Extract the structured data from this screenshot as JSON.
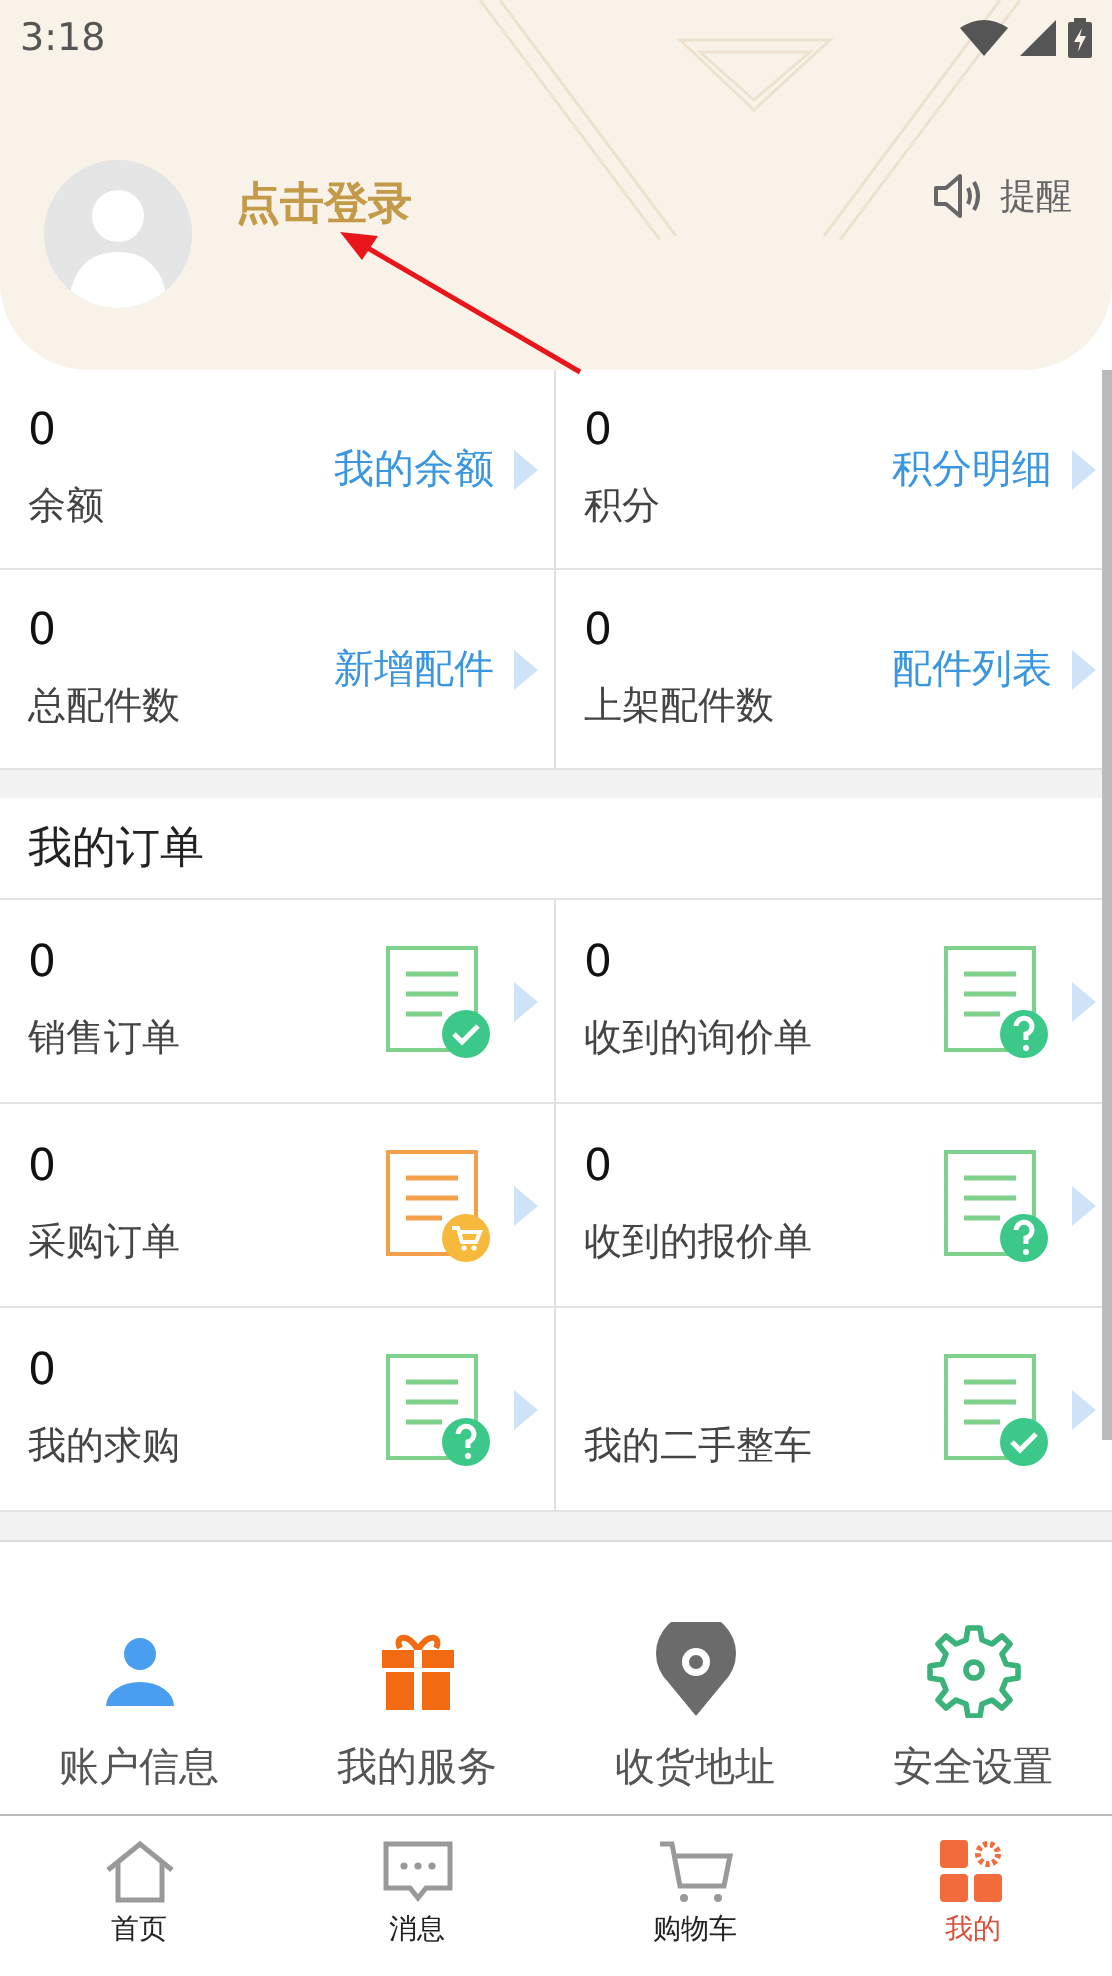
{
  "status_bar": {
    "time": "3:18"
  },
  "header": {
    "login_text": "点击登录",
    "reminder": "提醒"
  },
  "stats": [
    {
      "value": "0",
      "label": "余额",
      "link": "我的余额"
    },
    {
      "value": "0",
      "label": "积分",
      "link": "积分明细"
    },
    {
      "value": "0",
      "label": "总配件数",
      "link": "新增配件"
    },
    {
      "value": "0",
      "label": "上架配件数",
      "link": "配件列表"
    }
  ],
  "orders": {
    "title": "我的订单",
    "items": [
      {
        "value": "0",
        "label": "销售订单",
        "kind": "check"
      },
      {
        "value": "0",
        "label": "收到的询价单",
        "kind": "question"
      },
      {
        "value": "0",
        "label": "采购订单",
        "kind": "cart"
      },
      {
        "value": "0",
        "label": "收到的报价单",
        "kind": "question"
      },
      {
        "value": "0",
        "label": "我的求购",
        "kind": "question"
      },
      {
        "label": "我的二手整车",
        "kind": "check"
      }
    ]
  },
  "services": [
    {
      "label": "账户信息",
      "kind": "person"
    },
    {
      "label": "我的服务",
      "kind": "gift"
    },
    {
      "label": "收货地址",
      "kind": "pin"
    },
    {
      "label": "安全设置",
      "kind": "gear"
    }
  ],
  "nav": [
    {
      "label": "首页",
      "kind": "home",
      "selected": false
    },
    {
      "label": "消息",
      "kind": "message",
      "selected": false
    },
    {
      "label": "购物车",
      "kind": "cart",
      "selected": false
    },
    {
      "label": "我的",
      "kind": "grid",
      "selected": true
    }
  ]
}
